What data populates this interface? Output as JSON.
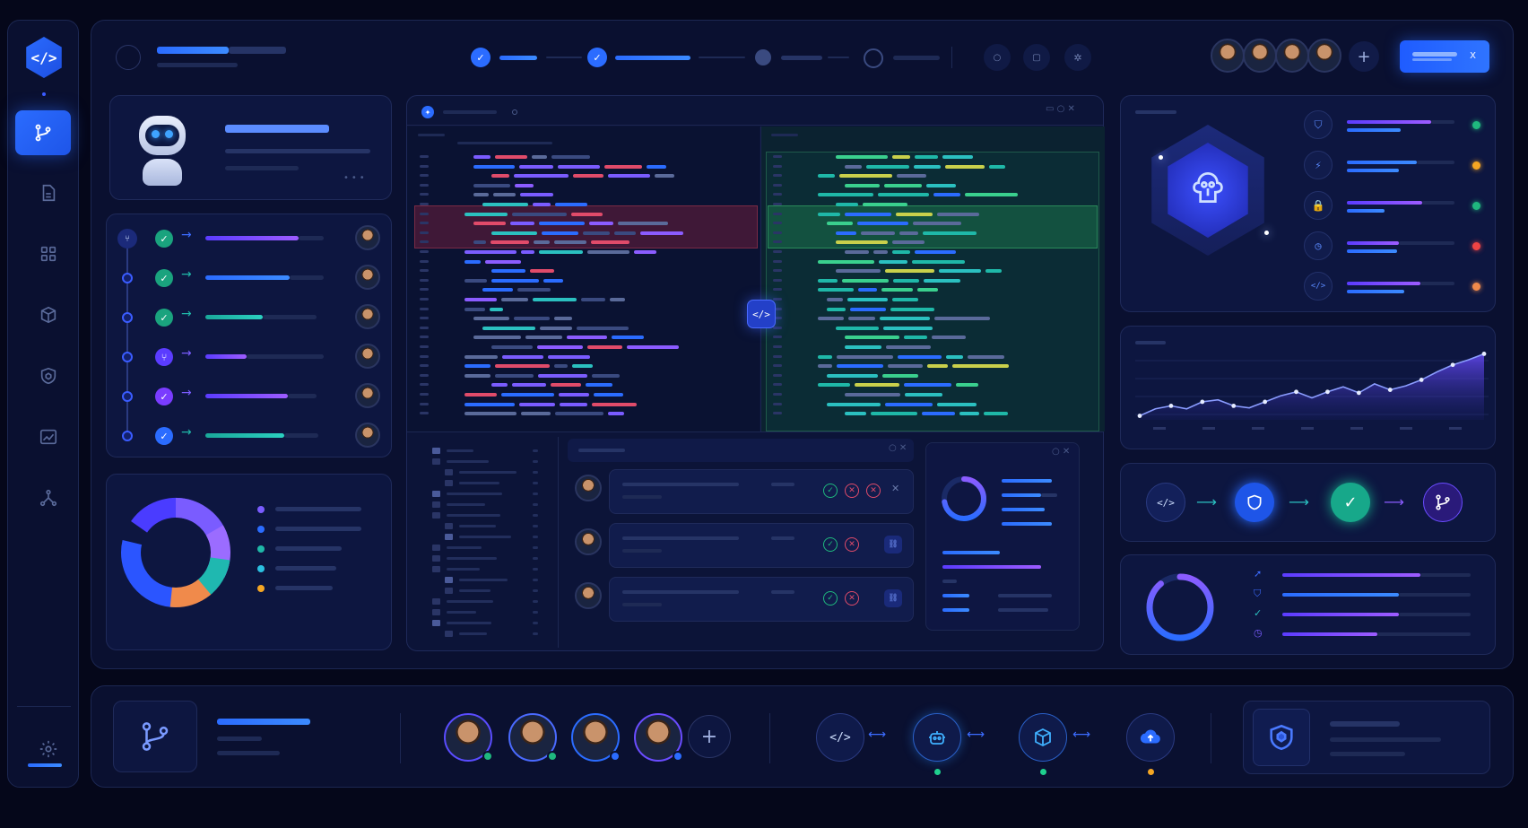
{
  "colors": {
    "accent": "#2b6cff",
    "violet": "#8b5cff",
    "teal": "#22c3b0",
    "success": "#22c55e",
    "danger": "#ef4444",
    "warning": "#f59e0b",
    "bg": "#05071a"
  },
  "sidebar": {
    "items": [
      "git-branch",
      "file",
      "grid",
      "package",
      "shield",
      "activity",
      "network"
    ],
    "bottom": "settings"
  },
  "header": {
    "steps": [
      "completed",
      "completed",
      "active",
      "pending"
    ],
    "tools": [
      "circle",
      "square",
      "puzzle"
    ],
    "primary_button": "x",
    "add_member": "+"
  },
  "code_panel": {
    "center_icon": "</>"
  },
  "pipeline_flow": [
    "code",
    "shield",
    "check",
    "branch"
  ],
  "footer": {
    "add_member": "+",
    "flow": [
      "code",
      "bot",
      "package",
      "cloud-upload"
    ]
  },
  "review_actions": [
    "approve",
    "reject",
    "close"
  ],
  "area_chart": {
    "points": [
      4,
      11,
      14,
      11,
      18,
      20,
      14,
      12,
      18,
      24,
      28,
      22,
      28,
      33,
      27,
      36,
      30,
      34,
      40,
      48,
      55,
      60,
      66
    ]
  }
}
